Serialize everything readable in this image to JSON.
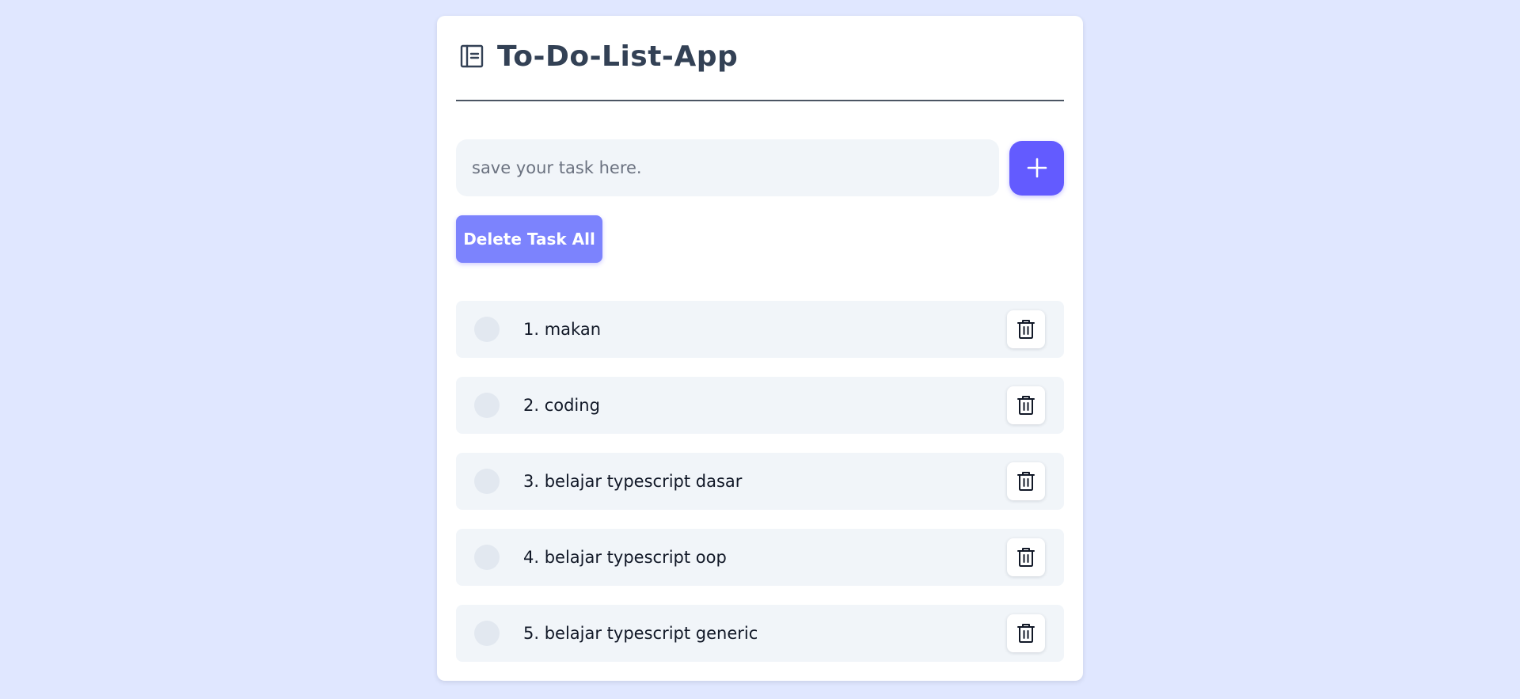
{
  "app": {
    "title": "To-Do-List-App",
    "logo_icon": "notebook-icon"
  },
  "form": {
    "input_placeholder": "save your task here.",
    "input_value": "",
    "add_icon": "plus-icon",
    "delete_all_label": "Delete Task All"
  },
  "tasks": [
    {
      "label": "1. makan",
      "completed": false,
      "delete_icon": "trash-icon"
    },
    {
      "label": "2. coding",
      "completed": false,
      "delete_icon": "trash-icon"
    },
    {
      "label": "3. belajar typescript dasar",
      "completed": false,
      "delete_icon": "trash-icon"
    },
    {
      "label": "4. belajar typescript oop",
      "completed": false,
      "delete_icon": "trash-icon"
    },
    {
      "label": "5. belajar typescript generic",
      "completed": false,
      "delete_icon": "trash-icon"
    }
  ],
  "colors": {
    "page_background": "#e0e7ff",
    "card_background": "#ffffff",
    "title_text": "#334155",
    "accent": "#635bff",
    "delete_all_button": "#7c83fd",
    "task_background": "#f1f5f9",
    "check_circle": "#e2e8f0"
  }
}
